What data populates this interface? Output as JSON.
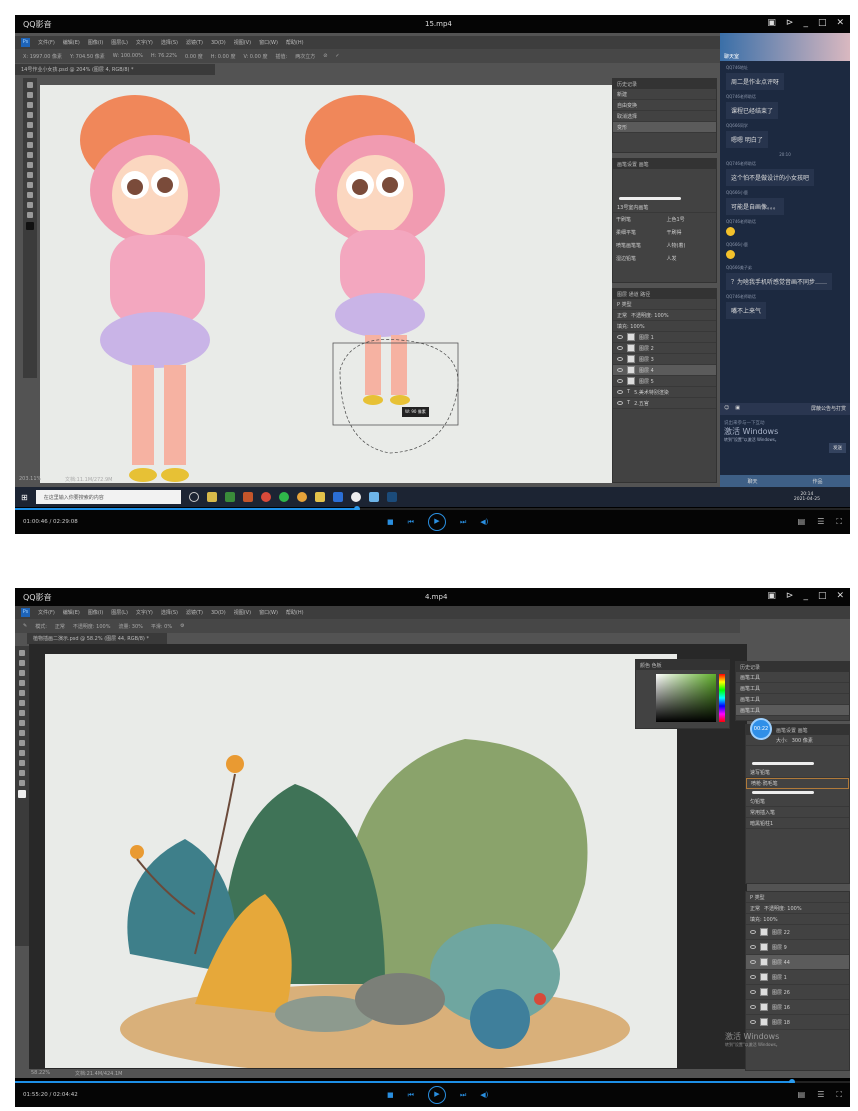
{
  "frame1": {
    "player": {
      "app": "QQ影音",
      "file": "15.mp4",
      "time": "01:00:46 / 02:29:08",
      "progress": 0.41
    },
    "ps": {
      "menu": [
        "文件(F)",
        "编辑(E)",
        "图像(I)",
        "图层(L)",
        "文字(Y)",
        "选择(S)",
        "滤镜(T)",
        "3D(D)",
        "视图(V)",
        "窗口(W)",
        "帮助(H)"
      ],
      "options": [
        "X: 1997.00 像素",
        "Y: 704.50 像素",
        "W: 100.00%",
        "H: 76.22%",
        "0.00 度",
        "H: 0.00 度",
        "V: 0.00 度",
        "插值:",
        "两次立方"
      ],
      "doc_tab": "14号作业小女孩.psd @ 204% (图层 4, RGB/8) *",
      "zoom": "203.11%",
      "doc_info": "文档:11.1M/272.9M",
      "tooltip": "W: 90 像素",
      "history": {
        "title": "历史记录",
        "items": [
          "新建",
          "自由变换",
          "取消选择",
          "变形"
        ]
      },
      "brushes": {
        "tabs": [
          "画笔设置",
          "画笔"
        ],
        "group": "13号室内画笔",
        "names": [
          "上色1号",
          "干刷笔",
          "柔细平笔",
          "干刷得",
          "喷笔画笔笔",
          "人物(着)",
          "湿边铅笔",
          "人发"
        ]
      },
      "layers": {
        "tabs": [
          "图层",
          "通道",
          "路径"
        ],
        "kind": "P 类型",
        "blend": "正常",
        "opacity": "不透明度: 100%",
        "fill": "填充: 100%",
        "items": [
          "图层 1",
          "图层 2",
          "图层 3",
          "图层 4",
          "图层 5",
          "5.美术特别渲染",
          "2.五官"
        ]
      }
    },
    "chat": {
      "header": "聊天室",
      "messages": [
        {
          "who": "QQ746地址",
          "text": "周二是作业点评呀"
        },
        {
          "who": "QQ746老师助话",
          "text": "课程已经结束了"
        },
        {
          "who": "QQ666同学",
          "text": "嗯嗯 明白了"
        },
        {
          "who": "QQ746老师助话",
          "text": "这个怕不是做设计的小女孩吧"
        },
        {
          "who": "QQ666小鹿",
          "text": "可能是自画像。。。"
        },
        {
          "who": "QQ746老师助话",
          "text": ""
        },
        {
          "who": "QQ666小鹿",
          "text": ""
        },
        {
          "who": "QQ666美子弟",
          "text": "？为啥我手机听感觉音画不同步……"
        },
        {
          "who": "QQ746老师助话",
          "text": "嘴不上来气"
        }
      ],
      "time_sep": "20:10",
      "checkbox": "屏蔽公告与打赏",
      "hint": "说出来参与一下互动",
      "activate": "激活 Windows",
      "activate_sub": "转到\"设置\"以激活 Windows。",
      "send": "发送",
      "tabs": [
        "聊天",
        "作品"
      ]
    },
    "taskbar": {
      "search": "在这里输入你要搜索的内容",
      "time": "20:14",
      "date": "2021-04-25"
    }
  },
  "frame2": {
    "player": {
      "app": "QQ影音",
      "file": "4.mp4",
      "time": "01:55:20 / 02:04:42",
      "progress": 0.93
    },
    "ps": {
      "menu": [
        "文件(F)",
        "编辑(E)",
        "图像(I)",
        "图层(L)",
        "文字(Y)",
        "选择(S)",
        "滤镜(T)",
        "3D(D)",
        "视图(V)",
        "窗口(W)",
        "帮助(H)"
      ],
      "options": [
        "模式:",
        "正常",
        "不透明度: 100%",
        "流量: 30%",
        "平滑: 0%"
      ],
      "doc_tab": "植物插画二演示.psd @ 58.2% (图层 44, RGB/8) *",
      "zoom": "58.22%",
      "doc_info": "文档:21.4M/424.1M",
      "color_tabs": [
        "颜色",
        "色板"
      ],
      "history": {
        "title": "历史记录",
        "items": [
          "画笔工具",
          "画笔工具",
          "画笔工具",
          "画笔工具"
        ]
      },
      "timer_badge": "00:22",
      "brushes": {
        "tabs": [
          "画笔设置",
          "画笔"
        ],
        "size": "大小:",
        "size_value": "300 像素",
        "names": [
          "速写铅笔",
          "喷枪·鸦毛笔",
          "匀铅笔",
          "常用插入笔",
          "暗黑铅柱1"
        ]
      },
      "layers": {
        "kind": "P 类型",
        "blend": "正常",
        "opacity": "不透明度: 100%",
        "fill": "填充: 100%",
        "items": [
          "图层 22",
          "图层 9",
          "图层 44",
          "图层 1",
          "图层 26",
          "图层 16",
          "图层 18"
        ]
      },
      "activate": "激活 Windows",
      "activate_sub": "转到\"设置\"以激活 Windows。"
    }
  },
  "colors": {
    "accent": "#1d8fe6",
    "ps_bg": "#535353",
    "chat_bg": "#1c2940"
  }
}
